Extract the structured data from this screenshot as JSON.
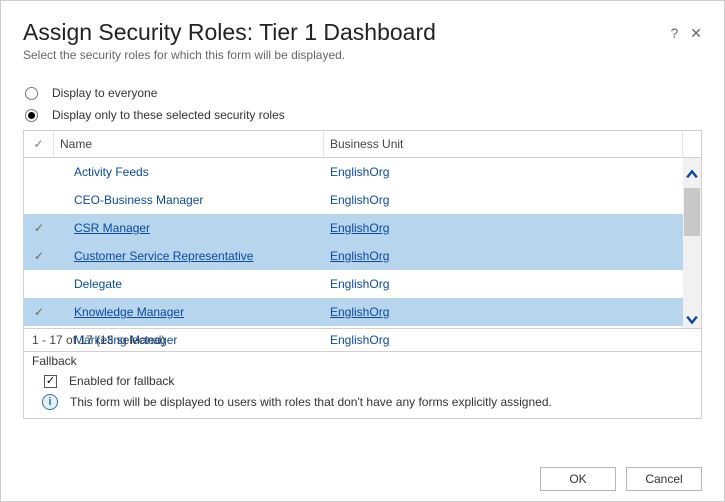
{
  "header": {
    "title": "Assign Security Roles: Tier 1 Dashboard",
    "subtitle": "Select the security roles for which this form will be displayed."
  },
  "display_options": {
    "everyone": "Display to everyone",
    "selected": "Display only to these selected security roles",
    "choice": "selected"
  },
  "grid": {
    "columns": {
      "name": "Name",
      "businessUnit": "Business Unit"
    },
    "rows": [
      {
        "name": "Activity Feeds",
        "businessUnit": "EnglishOrg",
        "selected": false
      },
      {
        "name": "CEO-Business Manager",
        "businessUnit": "EnglishOrg",
        "selected": false
      },
      {
        "name": "CSR Manager",
        "businessUnit": "EnglishOrg",
        "selected": true
      },
      {
        "name": "Customer Service Representative",
        "businessUnit": "EnglishOrg",
        "selected": true
      },
      {
        "name": "Delegate",
        "businessUnit": "EnglishOrg",
        "selected": false
      },
      {
        "name": "Knowledge Manager",
        "businessUnit": "EnglishOrg",
        "selected": true
      },
      {
        "name": "Marketing Manager",
        "businessUnit": "EnglishOrg",
        "selected": false
      }
    ],
    "footer": "1 - 17 of 17 (13 selected)"
  },
  "fallback": {
    "section_label": "Fallback",
    "enabled_label": "Enabled for fallback",
    "enabled": true,
    "info_text": "This form will be displayed to users with roles that don't have any forms explicitly assigned."
  },
  "buttons": {
    "ok": "OK",
    "cancel": "Cancel"
  }
}
